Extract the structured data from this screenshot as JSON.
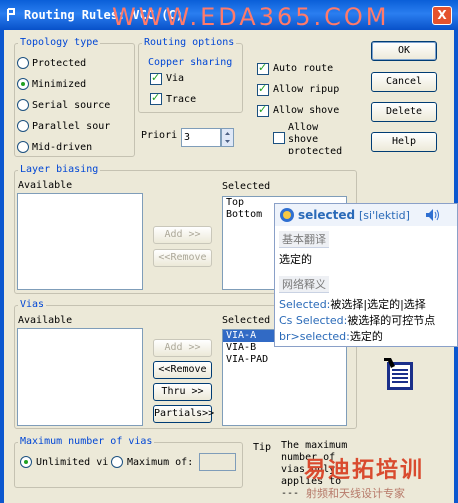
{
  "window": {
    "title": "Routing Rules: VCC  (C)",
    "close_label": "X",
    "watermark": "WWW.EDA365.COM"
  },
  "topology": {
    "legend": "Topology type",
    "options": [
      "Protected",
      "Minimized",
      "Serial source",
      "Parallel sour",
      "Mid-driven"
    ],
    "selected": "Minimized"
  },
  "routing_options": {
    "legend": "Routing options",
    "copper_legend": "Copper sharing",
    "via_label": "Via",
    "via_checked": true,
    "trace_label": "Trace",
    "trace_checked": true,
    "auto_route_label": "Auto route",
    "allow_ripup_label": "Allow ripup",
    "allow_shove_label": "Allow shove",
    "allow_shove_protected_label": [
      "Allow",
      "shove",
      "protected"
    ],
    "priority_label": "Priori",
    "priority_value": "3"
  },
  "buttons": {
    "ok": "OK",
    "cancel": "Cancel",
    "delete": "Delete",
    "help": "Help"
  },
  "layer_biasing": {
    "legend": "Layer biasing",
    "available_label": "Available",
    "selected_label": "Selected",
    "available_items": [],
    "selected_items": [
      "Top",
      "Bottom"
    ],
    "add_label": "Add >>",
    "remove_label": "<<Remove"
  },
  "vias": {
    "legend": "Vias",
    "available_label": "Available",
    "selected_label": "Selected",
    "available_items": [],
    "selected_items": [
      "VIA-A",
      "VIA-B",
      "VIA-PAD"
    ],
    "selected_index": 0,
    "add_label": "Add >>",
    "remove_label": "<<Remove",
    "thru_label": "Thru >>",
    "partials_label": "Partials>>"
  },
  "max_vias": {
    "legend": "Maximum number of vias",
    "unlimited_label": "Unlimited vi",
    "maximum_label": "Maximum of:",
    "selected": "Unlimited vi",
    "maximum_value": ""
  },
  "tip": {
    "label": "Tip",
    "lines": [
      "The maximum",
      "number of",
      "vias only",
      "applies to",
      "---"
    ]
  },
  "dictionary_popup": {
    "word": "selected",
    "phonetic": "[si'lektid]",
    "basic_header": "基本翻译",
    "basic_translation": "选定的",
    "web_header": "网络释义",
    "web_entries": [
      {
        "term": "Selected:",
        "meaning": "被选择|选定的|选择"
      },
      {
        "term": "Cs Selected:",
        "meaning": "被选择的可控节点"
      },
      {
        "term": "br>selected:",
        "meaning": "选定的"
      }
    ]
  },
  "footer_watermark": {
    "brand": "易迪拓培训",
    "slogan": "射频和天线设计专家"
  },
  "colors": {
    "title_bar": "#0a5fd8",
    "group_legend": "#0046d5",
    "selection": "#316ac5",
    "dict_term": "#2a6ab8",
    "watermark": "#d94a2e"
  }
}
